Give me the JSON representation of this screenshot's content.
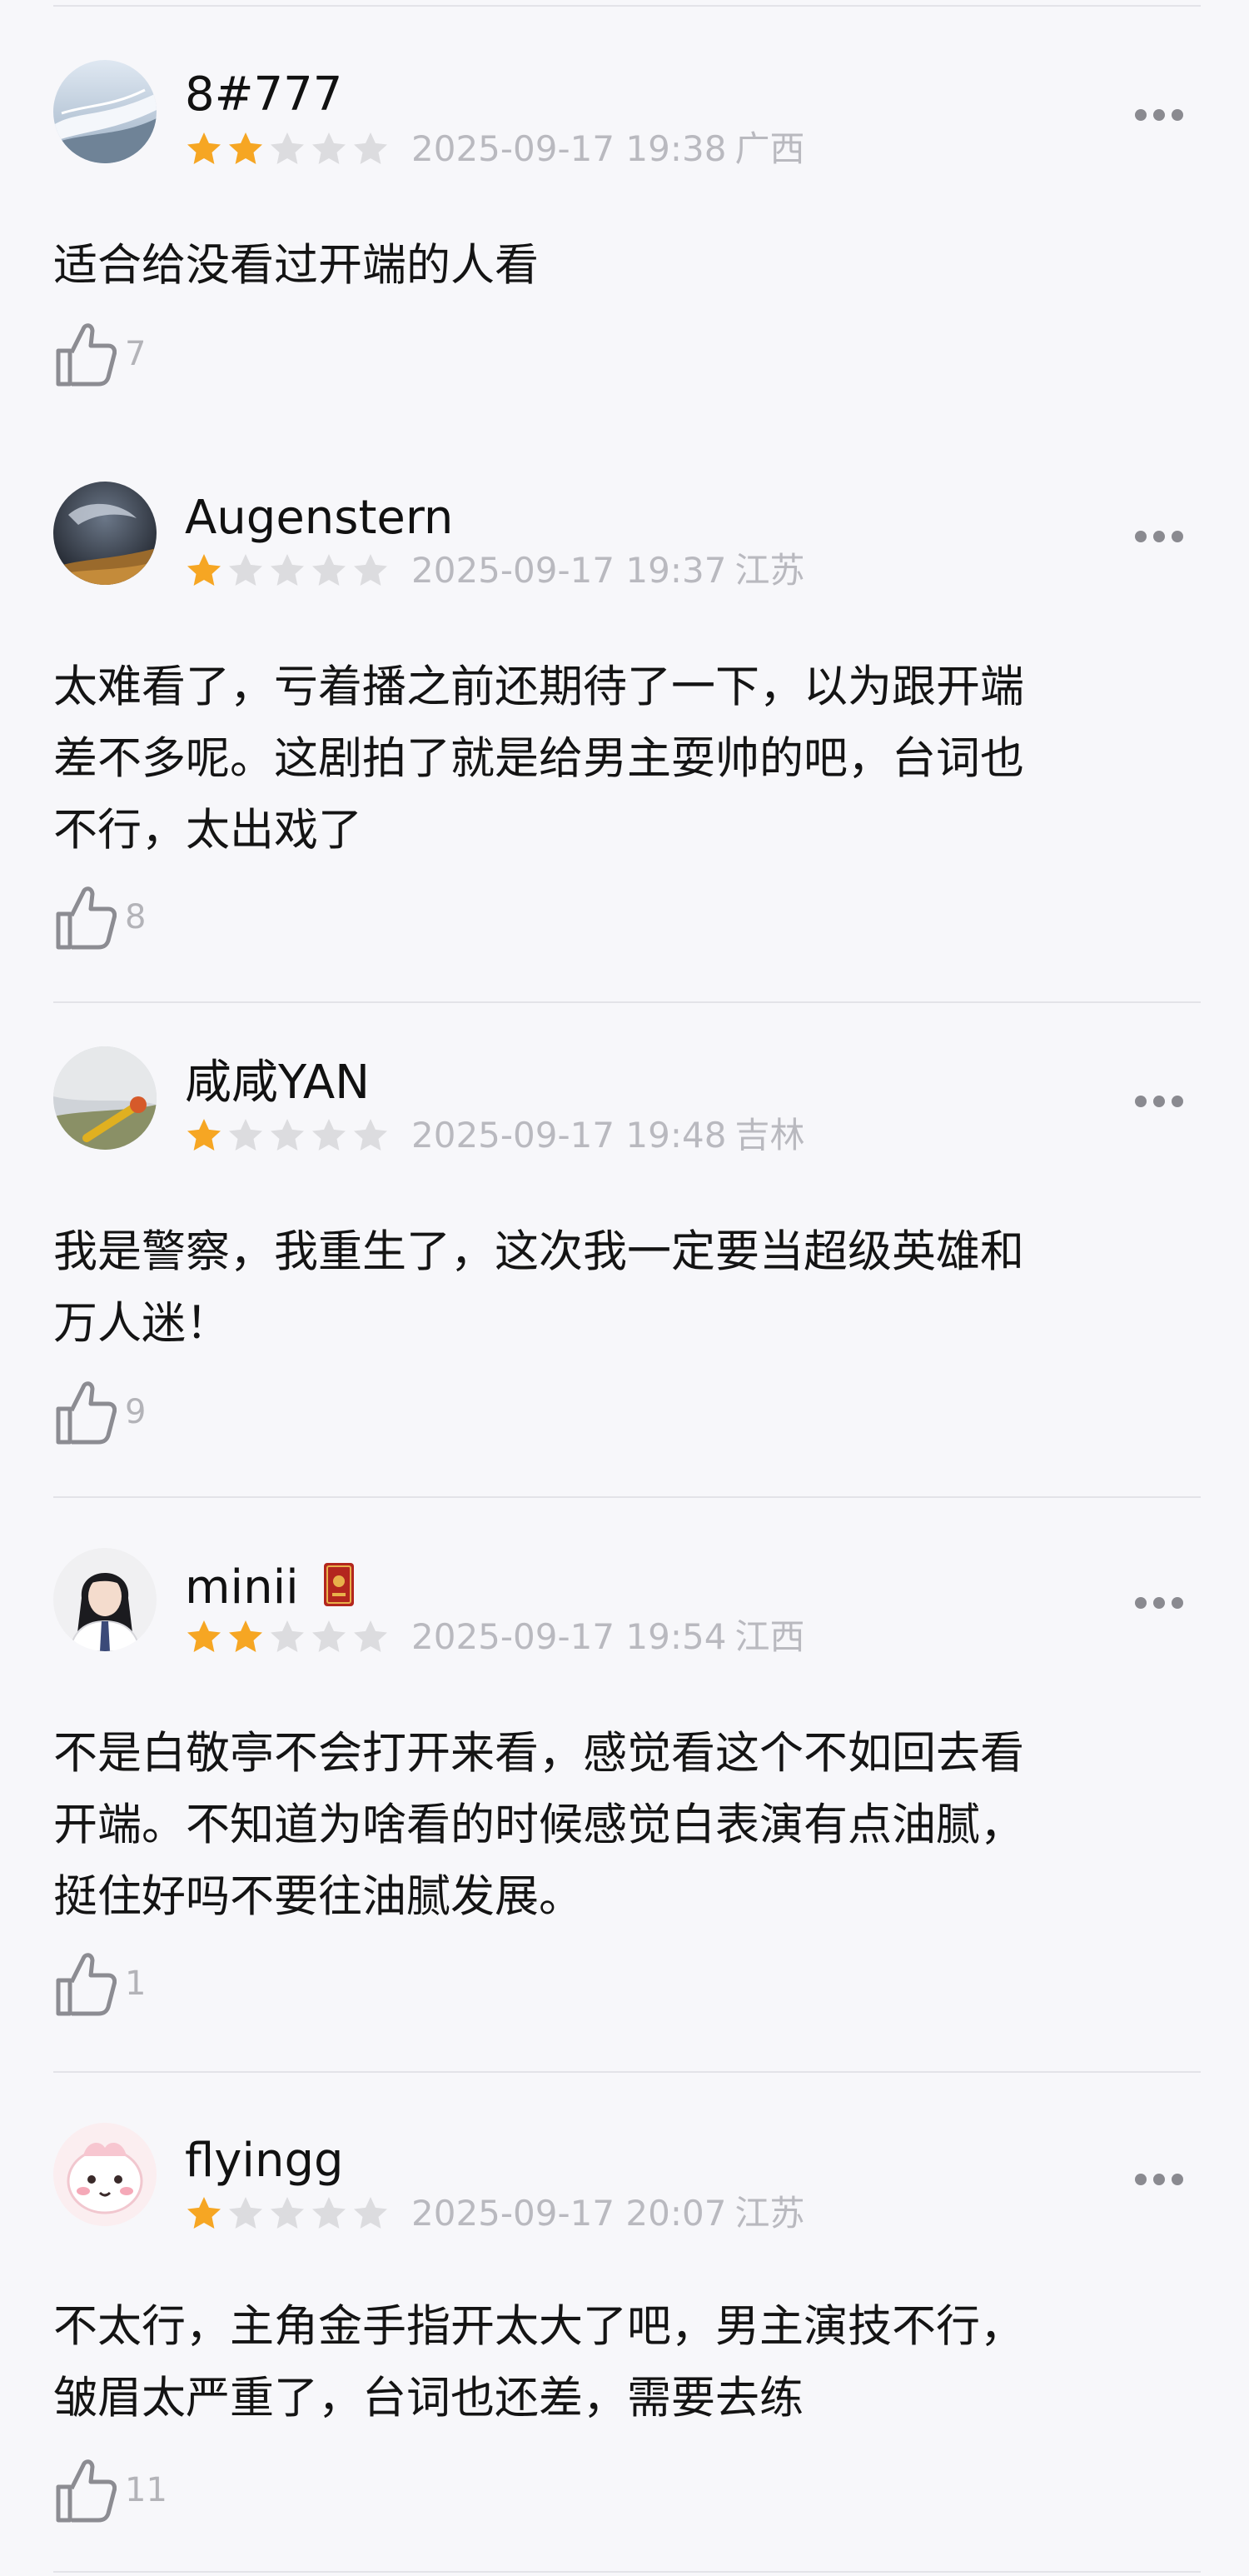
{
  "reviews": [
    {
      "username": "8#777",
      "rating": 2,
      "max_rating": 5,
      "datetime": "2025-09-17 19:38",
      "location": "广西",
      "content": "适合给没看过开端的人看",
      "likes": "7",
      "has_badge": false
    },
    {
      "username": "Augenstern",
      "rating": 1,
      "max_rating": 5,
      "datetime": "2025-09-17 19:37",
      "location": "江苏",
      "content": "太难看了，亏着播之前还期待了一下，以为跟开端\n差不多呢。这剧拍了就是给男主耍帅的吧，台词也\n不行，太出戏了",
      "likes": "8",
      "has_badge": false
    },
    {
      "username": "咸咸YAN",
      "rating": 1,
      "max_rating": 5,
      "datetime": "2025-09-17 19:48",
      "location": "吉林",
      "content": "我是警察，我重生了，这次我一定要当超级英雄和\n万人迷！",
      "likes": "9",
      "has_badge": false
    },
    {
      "username": "minii",
      "rating": 2,
      "max_rating": 5,
      "datetime": "2025-09-17 19:54",
      "location": "江西",
      "content": "不是白敬亭不会打开来看，感觉看这个不如回去看\n开端。不知道为啥看的时候感觉白表演有点油腻，\n挺住好吗不要往油腻发展。",
      "likes": "1",
      "has_badge": true
    },
    {
      "username": "flyingg",
      "rating": 1,
      "max_rating": 5,
      "datetime": "2025-09-17 20:07",
      "location": "江苏",
      "content": "不太行，主角金手指开太大了吧，男主演技不行，\n皱眉太严重了，台词也还差，需要去练",
      "likes": "11",
      "has_badge": false
    }
  ],
  "colors": {
    "star_filled": "#f6a623",
    "star_empty": "#dcdcdf",
    "meta_text": "#b9b9bf",
    "divider": "#e3e3e8",
    "background": "#f7f7fa"
  }
}
